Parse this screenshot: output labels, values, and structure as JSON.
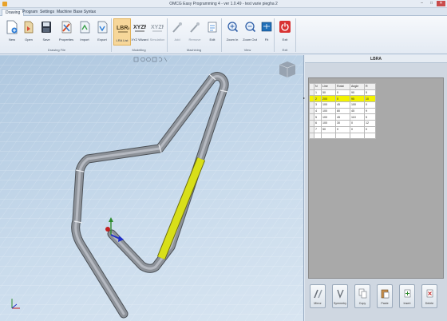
{
  "window": {
    "title": "OMCG Easy Programming 4 - ver 1.0.49 - test varie piegha 2"
  },
  "tabs": [
    {
      "label": "Drawing"
    },
    {
      "label": "Program"
    },
    {
      "label": "Settings"
    },
    {
      "label": "Machine"
    },
    {
      "label": "Base Syntax"
    }
  ],
  "ribbon": {
    "buttons": [
      {
        "label": "New",
        "icon": "new-document-icon"
      },
      {
        "label": "Open",
        "icon": "open-folder-icon"
      },
      {
        "label": "Save",
        "icon": "save-disk-icon"
      },
      {
        "label": "Properties",
        "icon": "properties-icon"
      },
      {
        "label": "Import",
        "icon": "import-icon"
      },
      {
        "label": "Export",
        "icon": "export-icon"
      },
      {
        "label": "LRA List",
        "icon": "lbra-icon"
      },
      {
        "label": "XYZ Wizard",
        "icon": "xyz-icon"
      },
      {
        "label": "Simulation",
        "icon": "simulation-icon"
      },
      {
        "label": "Add",
        "icon": "add-icon"
      },
      {
        "label": "Remove",
        "icon": "remove-icon"
      },
      {
        "label": "Edit",
        "icon": "edit-icon"
      },
      {
        "label": "Zoom In",
        "icon": "zoom-in-icon"
      },
      {
        "label": "Zoom Out",
        "icon": "zoom-out-icon"
      },
      {
        "label": "Fit",
        "icon": "fit-icon"
      },
      {
        "label": "Exit",
        "icon": "power-icon"
      }
    ],
    "groups": [
      {
        "label": "Drawing File"
      },
      {
        "label": "Modelling"
      },
      {
        "label": "Machining"
      },
      {
        "label": "View"
      },
      {
        "label": "Exit"
      }
    ]
  },
  "panel": {
    "title": "LBRA",
    "columns": [
      "N",
      "Line",
      "Rotat",
      "Angle",
      "R"
    ],
    "rows": [
      [
        "1",
        "50",
        "0",
        "90",
        "5"
      ],
      [
        "2",
        "200",
        "0",
        "95",
        "10"
      ],
      [
        "3",
        "100",
        "45",
        "100",
        "0"
      ],
      [
        "4",
        "100",
        "80",
        "45",
        "9"
      ],
      [
        "5",
        "100",
        "45",
        "110",
        "5"
      ],
      [
        "6",
        "100",
        "30",
        "0",
        "12"
      ],
      [
        "7",
        "50",
        "0",
        "0",
        "0"
      ]
    ],
    "selected_row": 2
  },
  "edit_buttons": [
    {
      "label": "Mirror",
      "icon": "mirror-icon"
    },
    {
      "label": "Symmetry",
      "icon": "symmetry-icon"
    },
    {
      "label": "Copy",
      "icon": "copy-icon"
    },
    {
      "label": "Paste",
      "icon": "paste-icon"
    },
    {
      "label": "Insert",
      "icon": "insert-icon"
    },
    {
      "label": "Delete",
      "icon": "delete-icon"
    }
  ],
  "colors": {
    "accent": "#f7d79a",
    "tube": "#8a8f96",
    "selected_segment": "#d8df19",
    "selected_row": "#f2f200"
  }
}
